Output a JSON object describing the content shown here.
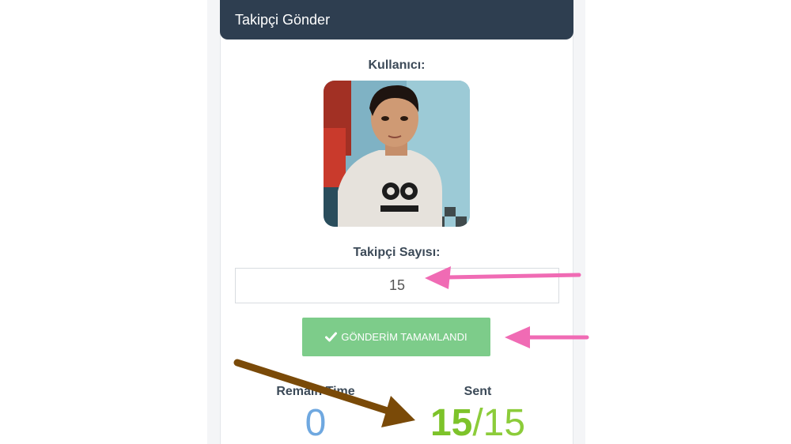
{
  "header": {
    "title": "Takipçi Gönder"
  },
  "user": {
    "label": "Kullanıcı:"
  },
  "follower_count": {
    "label": "Takipçi Sayısı:",
    "value": "15"
  },
  "submit_button": {
    "label": "GÖNDERİM TAMAMLANDI",
    "icon": "check-icon",
    "color": "#7dcc8a"
  },
  "stats": {
    "remaining": {
      "label": "Remain Time",
      "value": "0",
      "color": "#6fa8e0"
    },
    "sent": {
      "label": "Sent",
      "current": "15",
      "separator": "/",
      "total": "15",
      "color": "#7dc32a"
    }
  },
  "annotations": {
    "pink_arrow_color": "#f06bb4",
    "brown_arrow_color": "#7a4a08"
  }
}
